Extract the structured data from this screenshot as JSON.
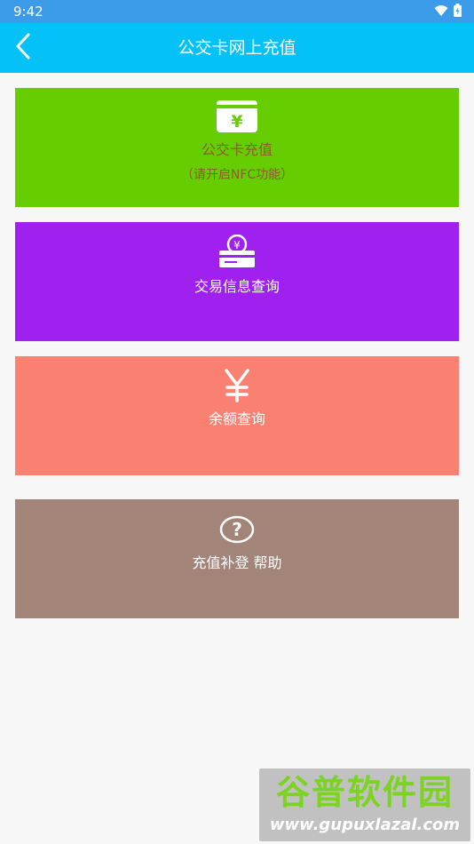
{
  "status_bar": {
    "time": "9:42"
  },
  "header": {
    "title": "公交卡网上充值",
    "back_icon": "chevron-left-icon"
  },
  "tiles": [
    {
      "label": "公交卡充值",
      "sublabel": "（请开启NFC功能）",
      "icon": "yen-card-icon",
      "color": "#66cd00",
      "text_color": "#8b5e2a"
    },
    {
      "label": "交易信息查询",
      "icon": "yen-coin-tray-icon",
      "color": "#a020f0",
      "text_color": "#ffffff"
    },
    {
      "label": "余额查询",
      "icon": "yen-icon",
      "color": "#fa8072",
      "text_color": "#ffffff"
    },
    {
      "label": "充值补登 帮助",
      "icon": "help-circle-icon",
      "color": "#a28478",
      "text_color": "#ffffff"
    }
  ],
  "watermark": {
    "title": "谷普软件园",
    "url": "www.gupuxlazal.com"
  }
}
